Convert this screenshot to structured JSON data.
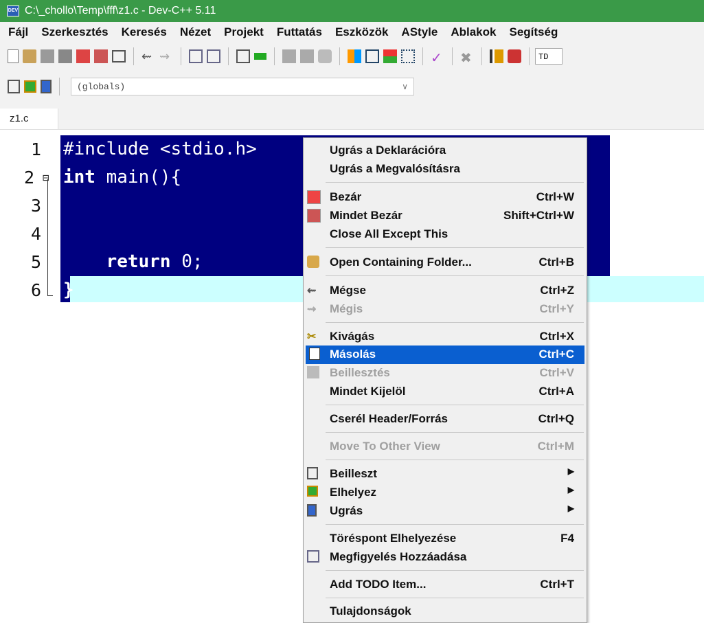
{
  "window": {
    "title": "C:\\_chollo\\Temp\\fff\\z1.c - Dev-C++ 5.11",
    "icon": "devcpp-icon"
  },
  "menubar": [
    "Fájl",
    "Szerkesztés",
    "Keresés",
    "Nézet",
    "Projekt",
    "Futtatás",
    "Eszközök",
    "AStyle",
    "Ablakok",
    "Segítség"
  ],
  "toolbar": {
    "combo_value": "(globals)",
    "partial_label": "TD"
  },
  "tab": {
    "label": "z1.c"
  },
  "editor": {
    "lines": [
      {
        "num": "1",
        "text": "#include <stdio.h>"
      },
      {
        "num": "2",
        "kw": "int",
        "text": " main(){"
      },
      {
        "num": "3",
        "text": ""
      },
      {
        "num": "4",
        "text": ""
      },
      {
        "num": "5",
        "kw": "    return",
        "text": " 0;"
      },
      {
        "num": "6",
        "text": "}"
      }
    ]
  },
  "context_menu": {
    "items": [
      {
        "label": "Ugrás a Deklarációra",
        "shortcut": ""
      },
      {
        "label": "Ugrás a Megvalósításra",
        "shortcut": ""
      },
      {
        "label": "Bezár",
        "shortcut": "Ctrl+W"
      },
      {
        "label": "Mindet Bezár",
        "shortcut": "Shift+Ctrl+W"
      },
      {
        "label": "Close All Except This",
        "shortcut": ""
      },
      {
        "label": "Open Containing Folder...",
        "shortcut": "Ctrl+B"
      },
      {
        "label": "Mégse",
        "shortcut": "Ctrl+Z"
      },
      {
        "label": "Mégis",
        "shortcut": "Ctrl+Y"
      },
      {
        "label": "Kivágás",
        "shortcut": "Ctrl+X"
      },
      {
        "label": "Másolás",
        "shortcut": "Ctrl+C"
      },
      {
        "label": "Beillesztés",
        "shortcut": "Ctrl+V"
      },
      {
        "label": "Mindet Kijelöl",
        "shortcut": "Ctrl+A"
      },
      {
        "label": "Cserél Header/Forrás",
        "shortcut": "Ctrl+Q"
      },
      {
        "label": "Move To Other View",
        "shortcut": "Ctrl+M"
      },
      {
        "label": "Beilleszt",
        "shortcut": ""
      },
      {
        "label": "Elhelyez",
        "shortcut": ""
      },
      {
        "label": "Ugrás",
        "shortcut": ""
      },
      {
        "label": "Töréspont Elhelyezése",
        "shortcut": "F4"
      },
      {
        "label": "Megfigyelés Hozzáadása",
        "shortcut": ""
      },
      {
        "label": "Add TODO Item...",
        "shortcut": "Ctrl+T"
      },
      {
        "label": "Tulajdonságok",
        "shortcut": ""
      }
    ]
  }
}
